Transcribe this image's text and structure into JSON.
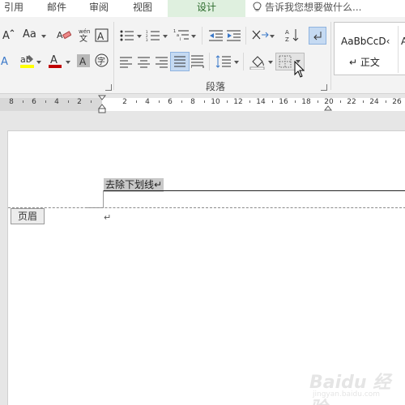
{
  "tabs": [
    {
      "label": "引用"
    },
    {
      "label": "邮件"
    },
    {
      "label": "审阅"
    },
    {
      "label": "视图"
    },
    {
      "label": "设计",
      "active": true
    }
  ],
  "tell_me": {
    "text": "告诉我您想要做什么..."
  },
  "ribbon": {
    "font_size_case_label": "Aa",
    "paragraph_group_label": "段落",
    "styles": {
      "sample": "AaBbCcD‹",
      "name": "↵ 正文",
      "sample2": "A"
    }
  },
  "ruler": {
    "labels": [
      "8",
      "6",
      "4",
      "2",
      "2",
      "4",
      "6",
      "8",
      "10",
      "12",
      "14",
      "16",
      "18",
      "20",
      "22",
      "24",
      "26"
    ]
  },
  "document": {
    "header_text": "去除下划线↵",
    "header_tag": "页眉",
    "paragraph_mark": "↵"
  },
  "watermark": {
    "text": "Baidu 经验",
    "sub": "jingyan.baidu.com"
  },
  "colors": {
    "font_color": "#c00000",
    "highlight_color": "#ffff00",
    "accent_active_tab": "#2a6a2a"
  }
}
